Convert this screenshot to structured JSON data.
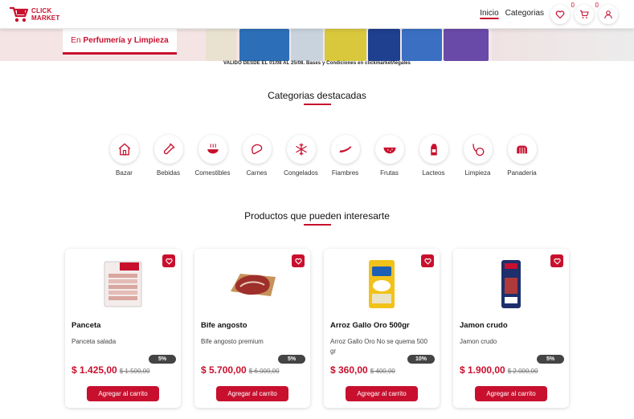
{
  "header": {
    "logo_line1": "CLICK",
    "logo_line2": "MARKET",
    "nav": {
      "home": "Inicio",
      "categories": "Categorias"
    },
    "wishlist_count": "0",
    "cart_count": "0",
    "icons": [
      "heart-icon",
      "cart-icon",
      "user-icon"
    ]
  },
  "banner": {
    "label_prefix": "En",
    "label_main": "Perfumería y Limpieza",
    "legal": "VALIDO DESDE EL 01/08 AL 25/08. Bases y Condiciones en clickmarket/legales"
  },
  "categories_section": {
    "title": "Categorias destacadas",
    "items": [
      {
        "label": "Bazar",
        "icon": "house-icon"
      },
      {
        "label": "Bebidas",
        "icon": "bottle-icon"
      },
      {
        "label": "Comestibles",
        "icon": "bowl-icon"
      },
      {
        "label": "Carnes",
        "icon": "meat-icon"
      },
      {
        "label": "Congelados",
        "icon": "snowflake-icon"
      },
      {
        "label": "Fiambres",
        "icon": "cold-cuts-icon"
      },
      {
        "label": "Frutas",
        "icon": "watermelon-icon"
      },
      {
        "label": "Lacteos",
        "icon": "milk-carton-icon"
      },
      {
        "label": "Limpieza",
        "icon": "vacuum-icon"
      },
      {
        "label": "Panaderia",
        "icon": "bread-icon"
      }
    ]
  },
  "products_section": {
    "title": "Productos que pueden interesarte",
    "add_to_cart_label": "Agregar al carrito",
    "products": [
      {
        "name": "Panceta",
        "description": "Panceta salada",
        "discount": "5%",
        "price": "$ 1.425,00",
        "old_price": "$ 1.500,00"
      },
      {
        "name": "Bife angosto",
        "description": "Bife angosto premium",
        "discount": "5%",
        "price": "$ 5.700,00",
        "old_price": "$ 6.000,00"
      },
      {
        "name": "Arroz Gallo Oro 500gr",
        "description": "Arroz Gallo Oro No se quema 500 gr",
        "discount": "10%",
        "price": "$ 360,00",
        "old_price": "$ 400,00"
      },
      {
        "name": "Jamon crudo",
        "description": "Jamon crudo",
        "discount": "5%",
        "price": "$ 1.900,00",
        "old_price": "$ 2.000,00"
      }
    ]
  },
  "colors": {
    "brand": "#c8102e",
    "badge": "#444444"
  }
}
